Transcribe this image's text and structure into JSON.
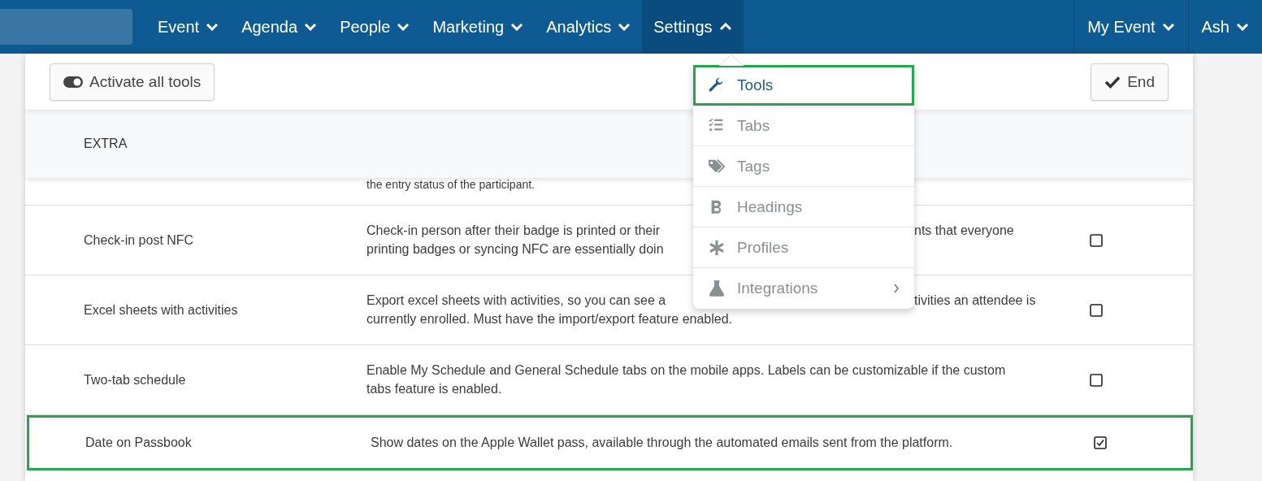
{
  "nav": {
    "items": [
      {
        "label": "Event",
        "expanded": false
      },
      {
        "label": "Agenda",
        "expanded": false
      },
      {
        "label": "People",
        "expanded": false
      },
      {
        "label": "Marketing",
        "expanded": false
      },
      {
        "label": "Analytics",
        "expanded": false
      },
      {
        "label": "Settings",
        "expanded": true
      }
    ],
    "right_items": [
      {
        "label": "My Event",
        "expanded": false
      },
      {
        "label": "Ash",
        "expanded": false
      }
    ]
  },
  "toolbar": {
    "activate_button": "Activate all tools",
    "end_button": "End"
  },
  "table": {
    "section": "EXTRA",
    "rows": [
      {
        "kind": "partial",
        "lines": [
          {
            "text": "the entry status of the participant."
          }
        ]
      },
      {
        "kind": "tool",
        "name": "Check-in post NFC",
        "lines": [
          {
            "text": "Check-in person after their badge is printed or their",
            "after": "nts that everyone"
          },
          {
            "text": "printing badges or syncing NFC are essentially doin"
          }
        ],
        "checked": false,
        "highlighted": false
      },
      {
        "kind": "tool",
        "name": "Excel sheets with activities",
        "lines": [
          {
            "text": "Export excel sheets with activities, so you can see a",
            "after": "tivities an attendee is"
          },
          {
            "text": "currently enrolled. Must have the import/export feature enabled."
          }
        ],
        "checked": false,
        "highlighted": false
      },
      {
        "kind": "tool",
        "name": "Two-tab schedule",
        "lines": [
          {
            "text": "Enable My Schedule and General Schedule tabs on the mobile apps. Labels can be customizable if the custom"
          },
          {
            "text": "tabs feature is enabled."
          }
        ],
        "checked": false,
        "highlighted": false
      },
      {
        "kind": "tool",
        "name": "Date on Passbook",
        "lines": [
          {
            "text": "Show dates on the Apple Wallet pass, available through the automated emails sent from the platform."
          }
        ],
        "checked": true,
        "highlighted": true
      }
    ]
  },
  "dropdown": {
    "items": [
      {
        "label": "Tools",
        "selected": true,
        "highlighted": true,
        "submenu": false
      },
      {
        "label": "Tabs",
        "selected": false,
        "highlighted": false,
        "submenu": false
      },
      {
        "label": "Tags",
        "selected": false,
        "highlighted": false,
        "submenu": false
      },
      {
        "label": "Headings",
        "selected": false,
        "highlighted": false,
        "submenu": false
      },
      {
        "label": "Profiles",
        "selected": false,
        "highlighted": false,
        "submenu": false
      },
      {
        "label": "Integrations",
        "selected": false,
        "highlighted": false,
        "submenu": true
      }
    ]
  }
}
